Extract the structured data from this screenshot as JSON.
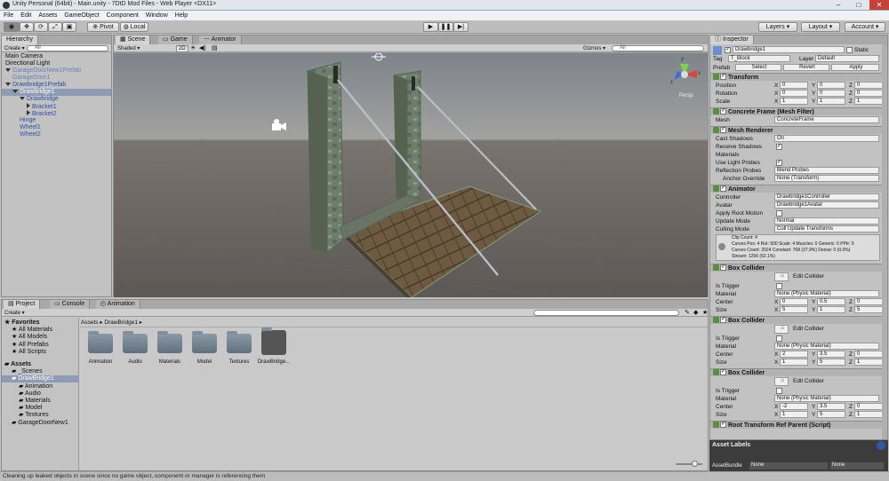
{
  "window": {
    "title": "Unity Personal (64bit) - Main.unity - 7DtD Mod Files - Web Player <DX11>"
  },
  "menu": [
    "File",
    "Edit",
    "Assets",
    "GameObject",
    "Component",
    "Window",
    "Help"
  ],
  "toolbar": {
    "pivot": "Pivot",
    "local": "Local",
    "layers": "Layers",
    "layout": "Layout",
    "account": "Account"
  },
  "hierarchy": {
    "tab": "Hierarchy",
    "create": "Create",
    "search": "All",
    "items": [
      {
        "label": "Main Camera",
        "indent": 0,
        "style": "normal"
      },
      {
        "label": "Directional Light",
        "indent": 0,
        "style": "normal"
      },
      {
        "label": "GarageDoorNew1Prefab",
        "indent": 0,
        "style": "lblue",
        "fold": "open"
      },
      {
        "label": "GarageDoor1",
        "indent": 1,
        "style": "lblue"
      },
      {
        "label": "Drawbridge1Prefab",
        "indent": 0,
        "style": "blue",
        "fold": "open"
      },
      {
        "label": "Drawbridge1",
        "indent": 1,
        "style": "sel",
        "fold": "open"
      },
      {
        "label": "Drawbridge",
        "indent": 2,
        "style": "blue",
        "fold": "open"
      },
      {
        "label": "Bracket1",
        "indent": 3,
        "style": "blue",
        "fold": "closed"
      },
      {
        "label": "Bracket2",
        "indent": 3,
        "style": "blue",
        "fold": "closed"
      },
      {
        "label": "Hinge",
        "indent": 2,
        "style": "blue"
      },
      {
        "label": "Wheel1",
        "indent": 2,
        "style": "blue"
      },
      {
        "label": "Wheel2",
        "indent": 2,
        "style": "blue"
      }
    ]
  },
  "scene": {
    "tabs": [
      "Scene",
      "Game",
      "Animator"
    ],
    "shading": "Shaded",
    "mode2d": "2D",
    "gizmos": "Gizmos",
    "search": "All",
    "persp": "Persp",
    "axes": {
      "y": "y",
      "x": "x",
      "z": "z"
    }
  },
  "project": {
    "tabs": [
      "Project",
      "Console",
      "Animation"
    ],
    "create": "Create",
    "breadcrumb_root": "Assets",
    "breadcrumb_current": "DrawBridge1",
    "favorites": {
      "title": "Favorites",
      "items": [
        "All Materials",
        "All Models",
        "All Prefabs",
        "All Scripts"
      ]
    },
    "assets_tree": {
      "title": "Assets",
      "items": [
        {
          "label": "_Scenes",
          "indent": 1
        },
        {
          "label": "DrawBridge1",
          "indent": 1,
          "selected": true
        },
        {
          "label": "Animation",
          "indent": 2
        },
        {
          "label": "Audio",
          "indent": 2
        },
        {
          "label": "Materials",
          "indent": 2
        },
        {
          "label": "Model",
          "indent": 2
        },
        {
          "label": "Textures",
          "indent": 2
        },
        {
          "label": "GarageDoorNew1",
          "indent": 1
        }
      ]
    },
    "grid": [
      "Animation",
      "Audio",
      "Materials",
      "Model",
      "Textures",
      "DrawBridge..."
    ]
  },
  "inspector": {
    "tab": "Inspector",
    "name": "Drawbridge1",
    "static": "Static",
    "tag_label": "Tag",
    "tag": "T_Block",
    "layer_label": "Layer",
    "layer": "Default",
    "prefab_label": "Prefab",
    "prefab_select": "Select",
    "prefab_revert": "Revert",
    "prefab_apply": "Apply",
    "transform": {
      "title": "Transform",
      "rows": [
        {
          "label": "Position",
          "x": "0",
          "y": "0",
          "z": "0"
        },
        {
          "label": "Rotation",
          "x": "0",
          "y": "0",
          "z": "0"
        },
        {
          "label": "Scale",
          "x": "1",
          "y": "1",
          "z": "1"
        }
      ]
    },
    "mesh_filter": {
      "title": "Concrete Frame (Mesh Filter)",
      "mesh_label": "Mesh",
      "mesh": "ConcreteFrame"
    },
    "mesh_renderer": {
      "title": "Mesh Renderer",
      "cast": "Cast Shadows",
      "cast_val": "On",
      "receive": "Receive Shadows",
      "materials": "Materials",
      "light_probes": "Use Light Probes",
      "refl": "Reflection Probes",
      "refl_val": "Blend Probes",
      "anchor": "Anchor Override",
      "anchor_val": "None (Transform)"
    },
    "animator": {
      "title": "Animator",
      "controller": "Controller",
      "controller_val": "Drawbridge1Controller",
      "avatar": "Avatar",
      "avatar_val": "Drawbridge1Avatar",
      "root_motion": "Apply Root Motion",
      "update": "Update Mode",
      "update_val": "Normal",
      "culling": "Culling Mode",
      "culling_val": "Cull Update Transforms",
      "info": [
        "Clip Count: 4",
        "Curves Pos: 4 Rot: 500 Scale: 4 Muscles: 0 Generic: 0 PPtr: 0",
        "Curves Count: 2024 Constant: 768 (37.9%) Dense: 0 (0.0%)",
        "Stream: 1256 (62.1%)"
      ]
    },
    "colliders": [
      {
        "title": "Box Collider",
        "edit": "Edit Collider",
        "trigger": "Is Trigger",
        "material": "Material",
        "material_val": "None (Physic Material)",
        "center": "Center",
        "cx": "0",
        "cy": "0.5",
        "cz": "0",
        "size": "Size",
        "sx": "5",
        "sy": "1",
        "sz": "5"
      },
      {
        "title": "Box Collider",
        "edit": "Edit Collider",
        "trigger": "Is Trigger",
        "material": "Material",
        "material_val": "None (Physic Material)",
        "center": "Center",
        "cx": "2",
        "cy": "3.5",
        "cz": "0",
        "size": "Size",
        "sx": "1",
        "sy": "5",
        "sz": "1"
      },
      {
        "title": "Box Collider",
        "edit": "Edit Collider",
        "trigger": "Is Trigger",
        "material": "Material",
        "material_val": "None (Physic Material)",
        "center": "Center",
        "cx": "-2",
        "cy": "3.5",
        "cz": "0",
        "size": "Size",
        "sx": "1",
        "sy": "5",
        "sz": "1"
      }
    ],
    "root_transform": "Root Transform Ref Parent (Script)",
    "asset_labels": "Asset Labels",
    "asset_bundle": "AssetBundle",
    "bundle_val": "None",
    "bundle_val2": "None"
  },
  "status": "Cleaning up leaked objects in scene since no game object, component or manager is referencing them"
}
